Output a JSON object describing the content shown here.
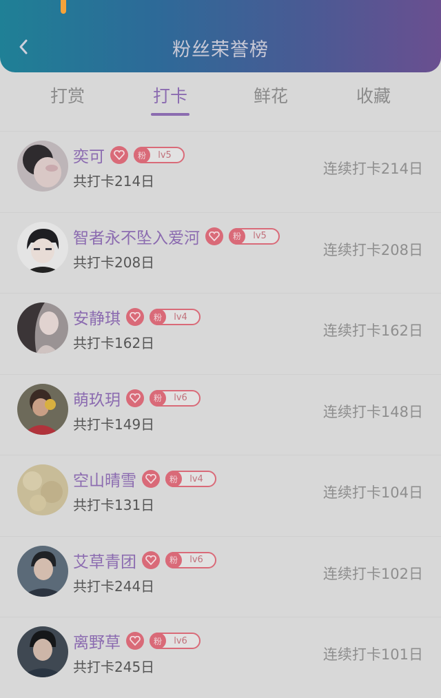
{
  "header": {
    "title": "粉丝荣誉榜",
    "back_icon": "chevron-left-icon"
  },
  "tabs": [
    {
      "label": "打赏",
      "active": false
    },
    {
      "label": "打卡",
      "active": true
    },
    {
      "label": "鲜花",
      "active": false
    },
    {
      "label": "收藏",
      "active": false
    }
  ],
  "badge": {
    "fan_label": "粉",
    "heart_icon": "heart-icon"
  },
  "colors": {
    "accent": "#8b6bb0",
    "badge": "#d96a78"
  },
  "entries": [
    {
      "name": "奕可",
      "level": "lv5",
      "total": "共打卡214日",
      "streak": "连续打卡214日"
    },
    {
      "name": "智者永不坠入爱河",
      "level": "lv5",
      "total": "共打卡208日",
      "streak": "连续打卡208日"
    },
    {
      "name": "安静琪",
      "level": "lv4",
      "total": "共打卡162日",
      "streak": "连续打卡162日"
    },
    {
      "name": "萌玖玥",
      "level": "lv6",
      "total": "共打卡149日",
      "streak": "连续打卡148日"
    },
    {
      "name": "空山晴雪",
      "level": "lv4",
      "total": "共打卡131日",
      "streak": "连续打卡104日"
    },
    {
      "name": "艾草青团",
      "level": "lv6",
      "total": "共打卡244日",
      "streak": "连续打卡102日"
    },
    {
      "name": "离野草",
      "level": "lv6",
      "total": "共打卡245日",
      "streak": "连续打卡101日"
    }
  ]
}
